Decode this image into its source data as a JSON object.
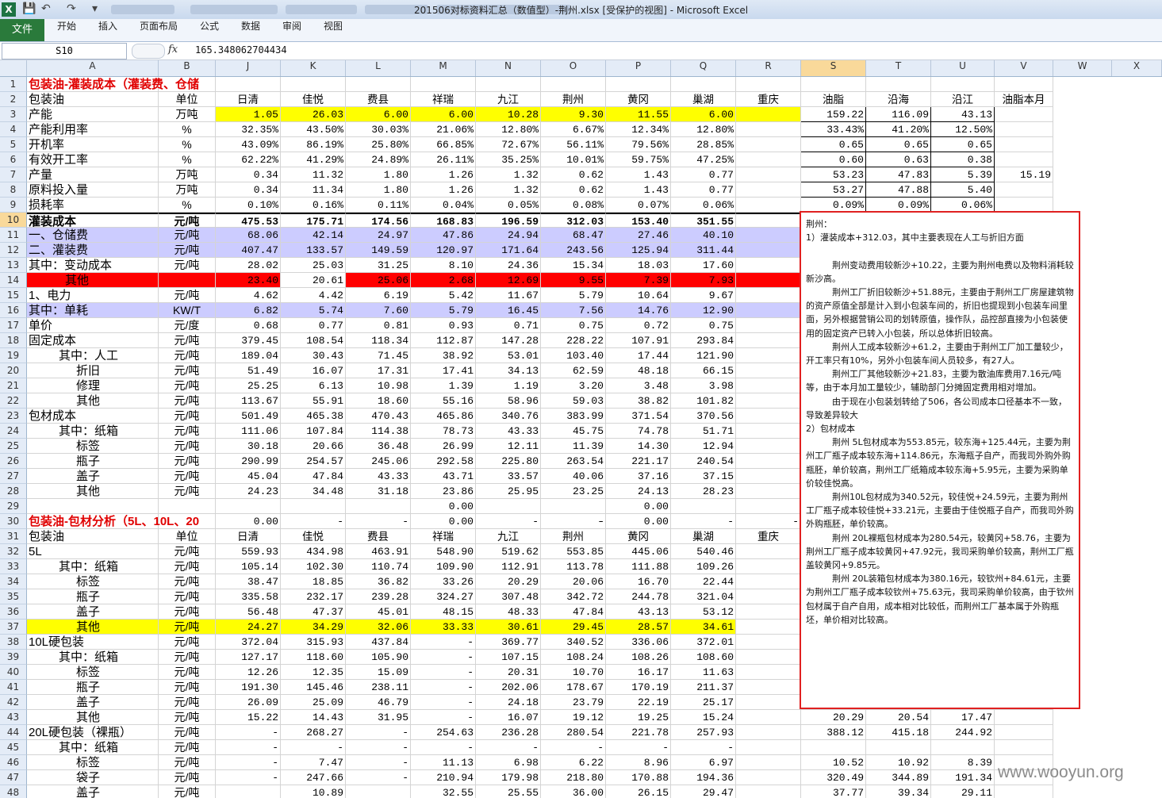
{
  "window": {
    "title": "201506对标资料汇总（数值型）-荆州.xlsx  [受保护的视图]  -  Microsoft Excel",
    "app_icon": "X"
  },
  "ribbon": {
    "file_tab": "文件",
    "tabs": [
      "开始",
      "插入",
      "页面布局",
      "公式",
      "数据",
      "审阅",
      "视图"
    ]
  },
  "formula_bar": {
    "name_box": "S10",
    "fx": "fx",
    "value": "165.348062704434"
  },
  "columns": [
    "A",
    "B",
    "J",
    "K",
    "L",
    "M",
    "N",
    "O",
    "P",
    "Q",
    "R",
    "S",
    "T",
    "U",
    "V",
    "W",
    "X"
  ],
  "selected_column": "S",
  "selected_row": "10",
  "rows": [
    {
      "n": "1",
      "cells": {
        "A": "包装油-灌装成本（灌装费、仓储"
      }
    },
    {
      "n": "2",
      "cells": {
        "A": "包装油",
        "B": "单位",
        "J": "日清",
        "K": "佳悦",
        "L": "费县",
        "M": "祥瑞",
        "N": "九江",
        "O": "荆州",
        "P": "黄冈",
        "Q": "巢湖",
        "R": "重庆",
        "S": "油脂",
        "T": "沿海",
        "U": "沿江",
        "V": "油脂本月"
      }
    },
    {
      "n": "3",
      "cells": {
        "A": "产能",
        "B": "万吨",
        "J": "1.05",
        "K": "26.03",
        "L": "6.00",
        "M": "6.00",
        "N": "10.28",
        "O": "9.30",
        "P": "11.55",
        "Q": "6.00",
        "S": "159.22",
        "T": "116.09",
        "U": "43.13"
      }
    },
    {
      "n": "4",
      "cells": {
        "A": "产能利用率",
        "B": "%",
        "J": "32.35%",
        "K": "43.50%",
        "L": "30.03%",
        "M": "21.06%",
        "N": "12.80%",
        "O": "6.67%",
        "P": "12.34%",
        "Q": "12.80%",
        "S": "33.43%",
        "T": "41.20%",
        "U": "12.50%"
      }
    },
    {
      "n": "5",
      "cells": {
        "A": "开机率",
        "B": "%",
        "J": "43.09%",
        "K": "86.19%",
        "L": "25.80%",
        "M": "66.85%",
        "N": "72.67%",
        "O": "56.11%",
        "P": "79.56%",
        "Q": "28.85%",
        "S": "0.65",
        "T": "0.65",
        "U": "0.65"
      }
    },
    {
      "n": "6",
      "cells": {
        "A": "有效开工率",
        "B": "%",
        "J": "62.22%",
        "K": "41.29%",
        "L": "24.89%",
        "M": "26.11%",
        "N": "35.25%",
        "O": "10.01%",
        "P": "59.75%",
        "Q": "47.25%",
        "S": "0.60",
        "T": "0.63",
        "U": "0.38"
      }
    },
    {
      "n": "7",
      "cells": {
        "A": "产量",
        "B": "万吨",
        "J": "0.34",
        "K": "11.32",
        "L": "1.80",
        "M": "1.26",
        "N": "1.32",
        "O": "0.62",
        "P": "1.43",
        "Q": "0.77",
        "S": "53.23",
        "T": "47.83",
        "U": "5.39",
        "V": "15.19"
      }
    },
    {
      "n": "8",
      "cells": {
        "A": "原料投入量",
        "B": "万吨",
        "J": "0.34",
        "K": "11.34",
        "L": "1.80",
        "M": "1.26",
        "N": "1.32",
        "O": "0.62",
        "P": "1.43",
        "Q": "0.77",
        "S": "53.27",
        "T": "47.88",
        "U": "5.40"
      }
    },
    {
      "n": "9",
      "cells": {
        "A": "损耗率",
        "B": "%",
        "J": "0.10%",
        "K": "0.16%",
        "L": "0.11%",
        "M": "0.04%",
        "N": "0.05%",
        "O": "0.08%",
        "P": "0.07%",
        "Q": "0.06%",
        "S": "0.09%",
        "T": "0.09%",
        "U": "0.06%"
      }
    },
    {
      "n": "10",
      "cells": {
        "A": "灌装成本",
        "B": "元/吨",
        "J": "475.53",
        "K": "175.71",
        "L": "174.56",
        "M": "168.83",
        "N": "196.59",
        "O": "312.03",
        "P": "153.40",
        "Q": "351.55"
      }
    },
    {
      "n": "11",
      "cells": {
        "A": "一、仓储费",
        "B": "元/吨",
        "J": "68.06",
        "K": "42.14",
        "L": "24.97",
        "M": "47.86",
        "N": "24.94",
        "O": "68.47",
        "P": "27.46",
        "Q": "40.10"
      }
    },
    {
      "n": "12",
      "cells": {
        "A": "二、灌装费",
        "B": "元/吨",
        "J": "407.47",
        "K": "133.57",
        "L": "149.59",
        "M": "120.97",
        "N": "171.64",
        "O": "243.56",
        "P": "125.94",
        "Q": "311.44"
      }
    },
    {
      "n": "13",
      "cells": {
        "A": "其中：变动成本",
        "B": "元/吨",
        "J": "28.02",
        "K": "25.03",
        "L": "31.25",
        "M": "8.10",
        "N": "24.36",
        "O": "15.34",
        "P": "18.03",
        "Q": "17.60"
      }
    },
    {
      "n": "14",
      "cells": {
        "A": "其他",
        "J": "23.40",
        "K": "20.61",
        "L": "25.06",
        "M": "2.68",
        "N": "12.69",
        "O": "9.55",
        "P": "7.39",
        "Q": "7.93"
      }
    },
    {
      "n": "15",
      "cells": {
        "A": "1、电力",
        "B": "元/吨",
        "J": "4.62",
        "K": "4.42",
        "L": "6.19",
        "M": "5.42",
        "N": "11.67",
        "O": "5.79",
        "P": "10.64",
        "Q": "9.67"
      }
    },
    {
      "n": "16",
      "cells": {
        "A": "其中：单耗",
        "B": "KW/T",
        "J": "6.82",
        "K": "5.74",
        "L": "7.60",
        "M": "5.79",
        "N": "16.45",
        "O": "7.56",
        "P": "14.76",
        "Q": "12.90"
      }
    },
    {
      "n": "17",
      "cells": {
        "A": "单价",
        "B": "元/度",
        "J": "0.68",
        "K": "0.77",
        "L": "0.81",
        "M": "0.93",
        "N": "0.71",
        "O": "0.75",
        "P": "0.72",
        "Q": "0.75"
      }
    },
    {
      "n": "18",
      "cells": {
        "A": "固定成本",
        "B": "元/吨",
        "J": "379.45",
        "K": "108.54",
        "L": "118.34",
        "M": "112.87",
        "N": "147.28",
        "O": "228.22",
        "P": "107.91",
        "Q": "293.84"
      }
    },
    {
      "n": "19",
      "cells": {
        "A": "其中：人工",
        "B": "元/吨",
        "J": "189.04",
        "K": "30.43",
        "L": "71.45",
        "M": "38.92",
        "N": "53.01",
        "O": "103.40",
        "P": "17.44",
        "Q": "121.90"
      }
    },
    {
      "n": "20",
      "cells": {
        "A": "折旧",
        "B": "元/吨",
        "J": "51.49",
        "K": "16.07",
        "L": "17.31",
        "M": "17.41",
        "N": "34.13",
        "O": "62.59",
        "P": "48.18",
        "Q": "66.15"
      }
    },
    {
      "n": "21",
      "cells": {
        "A": "修理",
        "B": "元/吨",
        "J": "25.25",
        "K": "6.13",
        "L": "10.98",
        "M": "1.39",
        "N": "1.19",
        "O": "3.20",
        "P": "3.48",
        "Q": "3.98"
      }
    },
    {
      "n": "22",
      "cells": {
        "A": "其他",
        "B": "元/吨",
        "J": "113.67",
        "K": "55.91",
        "L": "18.60",
        "M": "55.16",
        "N": "58.96",
        "O": "59.03",
        "P": "38.82",
        "Q": "101.82"
      }
    },
    {
      "n": "23",
      "cells": {
        "A": "包材成本",
        "B": "元/吨",
        "J": "501.49",
        "K": "465.38",
        "L": "470.43",
        "M": "465.86",
        "N": "340.76",
        "O": "383.99",
        "P": "371.54",
        "Q": "370.56"
      }
    },
    {
      "n": "24",
      "cells": {
        "A": "其中：纸箱",
        "B": "元/吨",
        "J": "111.06",
        "K": "107.84",
        "L": "114.38",
        "M": "78.73",
        "N": "43.33",
        "O": "45.75",
        "P": "74.78",
        "Q": "51.71"
      }
    },
    {
      "n": "25",
      "cells": {
        "A": "标签",
        "B": "元/吨",
        "J": "30.18",
        "K": "20.66",
        "L": "36.48",
        "M": "26.99",
        "N": "12.11",
        "O": "11.39",
        "P": "14.30",
        "Q": "12.94"
      }
    },
    {
      "n": "26",
      "cells": {
        "A": "瓶子",
        "B": "元/吨",
        "J": "290.99",
        "K": "254.57",
        "L": "245.06",
        "M": "292.58",
        "N": "225.80",
        "O": "263.54",
        "P": "221.17",
        "Q": "240.54"
      }
    },
    {
      "n": "27",
      "cells": {
        "A": "盖子",
        "B": "元/吨",
        "J": "45.04",
        "K": "47.84",
        "L": "43.33",
        "M": "43.71",
        "N": "33.57",
        "O": "40.06",
        "P": "37.16",
        "Q": "37.15"
      }
    },
    {
      "n": "28",
      "cells": {
        "A": "其他",
        "B": "元/吨",
        "J": "24.23",
        "K": "34.48",
        "L": "31.18",
        "M": "23.86",
        "N": "25.95",
        "O": "23.25",
        "P": "24.13",
        "Q": "28.23"
      }
    },
    {
      "n": "29",
      "cells": {
        "M": "0.00",
        "P": "0.00"
      }
    },
    {
      "n": "30",
      "cells": {
        "A": "包装油-包材分析（5L、10L、20",
        "J": "0.00",
        "K": "-",
        "L": "-",
        "M": "0.00",
        "N": "-",
        "O": "-",
        "O2": "-",
        "P": "0.00",
        "Q": "-",
        "R": "-"
      }
    },
    {
      "n": "31",
      "cells": {
        "A": "包装油",
        "B": "单位",
        "J": "日清",
        "K": "佳悦",
        "L": "费县",
        "M": "祥瑞",
        "N": "九江",
        "O": "荆州",
        "P": "黄冈",
        "Q": "巢湖",
        "R": "重庆"
      }
    },
    {
      "n": "32",
      "cells": {
        "A": "5L",
        "B": "元/吨",
        "J": "559.93",
        "K": "434.98",
        "L": "463.91",
        "M": "548.90",
        "N": "519.62",
        "O": "553.85",
        "P": "445.06",
        "Q": "540.46"
      }
    },
    {
      "n": "33",
      "cells": {
        "A": "其中：纸箱",
        "B": "元/吨",
        "J": "105.14",
        "K": "102.30",
        "L": "110.74",
        "M": "109.90",
        "N": "112.91",
        "O": "113.78",
        "P": "111.88",
        "Q": "109.26"
      }
    },
    {
      "n": "34",
      "cells": {
        "A": "标签",
        "B": "元/吨",
        "J": "38.47",
        "K": "18.85",
        "L": "36.82",
        "M": "33.26",
        "N": "20.29",
        "O": "20.06",
        "P": "16.70",
        "Q": "22.44"
      }
    },
    {
      "n": "35",
      "cells": {
        "A": "瓶子",
        "B": "元/吨",
        "J": "335.58",
        "K": "232.17",
        "L": "239.28",
        "M": "324.27",
        "N": "307.48",
        "O": "342.72",
        "P": "244.78",
        "Q": "321.04"
      }
    },
    {
      "n": "36",
      "cells": {
        "A": "盖子",
        "B": "元/吨",
        "J": "56.48",
        "K": "47.37",
        "L": "45.01",
        "M": "48.15",
        "N": "48.33",
        "O": "47.84",
        "P": "43.13",
        "Q": "53.12"
      }
    },
    {
      "n": "37",
      "cells": {
        "A": "其他",
        "B": "元/吨",
        "J": "24.27",
        "K": "34.29",
        "L": "32.06",
        "M": "33.33",
        "N": "30.61",
        "O": "29.45",
        "P": "28.57",
        "Q": "34.61"
      }
    },
    {
      "n": "38",
      "cells": {
        "A": "10L硬包装",
        "B": "元/吨",
        "J": "372.04",
        "K": "315.93",
        "L": "437.84",
        "M": "-",
        "N": "369.77",
        "O": "340.52",
        "P": "336.06",
        "Q": "372.01"
      }
    },
    {
      "n": "39",
      "cells": {
        "A": "其中：纸箱",
        "B": "元/吨",
        "J": "127.17",
        "K": "118.60",
        "L": "105.90",
        "M": "-",
        "N": "107.15",
        "O": "108.24",
        "P": "108.26",
        "Q": "108.60"
      }
    },
    {
      "n": "40",
      "cells": {
        "A": "标签",
        "B": "元/吨",
        "J": "12.26",
        "K": "12.35",
        "L": "15.09",
        "M": "-",
        "N": "20.31",
        "O": "10.70",
        "P": "16.17",
        "Q": "11.63"
      }
    },
    {
      "n": "41",
      "cells": {
        "A": "瓶子",
        "B": "元/吨",
        "J": "191.30",
        "K": "145.46",
        "L": "238.11",
        "M": "-",
        "N": "202.06",
        "O": "178.67",
        "P": "170.19",
        "Q": "211.37"
      }
    },
    {
      "n": "42",
      "cells": {
        "A": "盖子",
        "B": "元/吨",
        "J": "26.09",
        "K": "25.09",
        "L": "46.79",
        "M": "-",
        "N": "24.18",
        "O": "23.79",
        "P": "22.19",
        "Q": "25.17"
      }
    },
    {
      "n": "43",
      "cells": {
        "A": "其他",
        "B": "元/吨",
        "J": "15.22",
        "K": "14.43",
        "L": "31.95",
        "M": "-",
        "N": "16.07",
        "O": "19.12",
        "P": "19.25",
        "Q": "15.24",
        "S": "20.29",
        "T": "20.54",
        "U": "17.47"
      }
    },
    {
      "n": "44",
      "cells": {
        "A": "20L硬包装（裸瓶）",
        "B": "元/吨",
        "J": "-",
        "K": "268.27",
        "L": "-",
        "M": "254.63",
        "N": "236.28",
        "O": "280.54",
        "P": "221.78",
        "Q": "257.93",
        "S": "388.12",
        "T": "415.18",
        "U": "244.92"
      }
    },
    {
      "n": "45",
      "cells": {
        "A": "其中：纸箱",
        "B": "元/吨",
        "J": "-",
        "K": "-",
        "L": "-",
        "M": "-",
        "N": "-",
        "O": "-",
        "P": "-",
        "Q": "-"
      }
    },
    {
      "n": "46",
      "cells": {
        "A": "标签",
        "B": "元/吨",
        "J": "-",
        "K": "7.47",
        "L": "-",
        "M": "11.13",
        "N": "6.98",
        "O": "6.22",
        "P": "8.96",
        "Q": "6.97",
        "S": "10.52",
        "T": "10.92",
        "U": "8.39"
      }
    },
    {
      "n": "47",
      "cells": {
        "A": "袋子",
        "B": "元/吨",
        "J": "-",
        "K": "247.66",
        "L": "-",
        "M": "210.94",
        "N": "179.98",
        "O": "218.80",
        "P": "170.88",
        "Q": "194.36",
        "S": "320.49",
        "T": "344.89",
        "U": "191.34"
      }
    },
    {
      "n": "48",
      "cells": {
        "A": "盖子",
        "B": "元/吨",
        "K": "10.89",
        "M": "32.55",
        "N": "25.55",
        "O": "36.00",
        "P": "26.15",
        "Q": "29.47",
        "S": "37.77",
        "T": "39.34",
        "U": "29.11"
      }
    }
  ],
  "note": {
    "lines": [
      "荆州：",
      "1）灌装成本+312.03，其中主要表现在人工与折旧方面",
      "",
      "　　　荆州变动费用较新沙+10.22，主要为荆州电费以及物料消耗较新沙高。",
      "　　　荆州工厂折旧较新沙+51.88元，主要由于荆州工厂房屋建筑物的资产原值全部是计入到小包装车间的，折旧也提现到小包装车间里面，另外根据营销公司的划转原值，操作队，品控部直接为小包装使用的固定资产已转入小包装，所以总体折旧较高。",
      "　　　荆州人工成本较新沙+61.2，主要由于荆州工厂加工量较少，开工率只有10%，另外小包装车间人员较多，有27人。",
      "　　　荆州工厂其他较新沙+21.83，主要为散油库费用7.16元/吨等，由于本月加工量较少，辅助部门分摊固定费用相对增加。",
      "　　　由于现在小包装划转给了506，各公司成本口径基本不一致，导致差异较大",
      "2）包材成本",
      "　　　荆州 5L包材成本为553.85元，较东海+125.44元，主要为荆州工厂瓶子成本较东海+114.86元，东海瓶子自产，而我司外购外购瓶胚，单价较高，荆州工厂纸箱成本较东海+5.95元，主要为采购单价较佳悦高。",
      "　　　荆州10L包材成为340.52元，较佳悦+24.59元，主要为荆州工厂瓶子成本较佳悦+33.21元，主要由于佳悦瓶子自产，而我司外购外购瓶胚，单价较高。",
      "　　　荆州 20L裸瓶包材成本为280.54元，较黄冈+58.76，主要为荆州工厂瓶子成本较黄冈+47.92元，我司采购单价较高，荆州工厂瓶盖较黄冈+9.85元。",
      "　　　荆州 20L装箱包材成本为380.16元，较钦州+84.61元，主要为荆州工厂瓶子成本较钦州+75.63元，我司采购单价较高，由于钦州包材属于自产自用，成本相对比较低，而荆州工厂基本属于外购瓶坯，单价相对比较高。"
    ]
  },
  "watermark": "www.wooyun.org"
}
